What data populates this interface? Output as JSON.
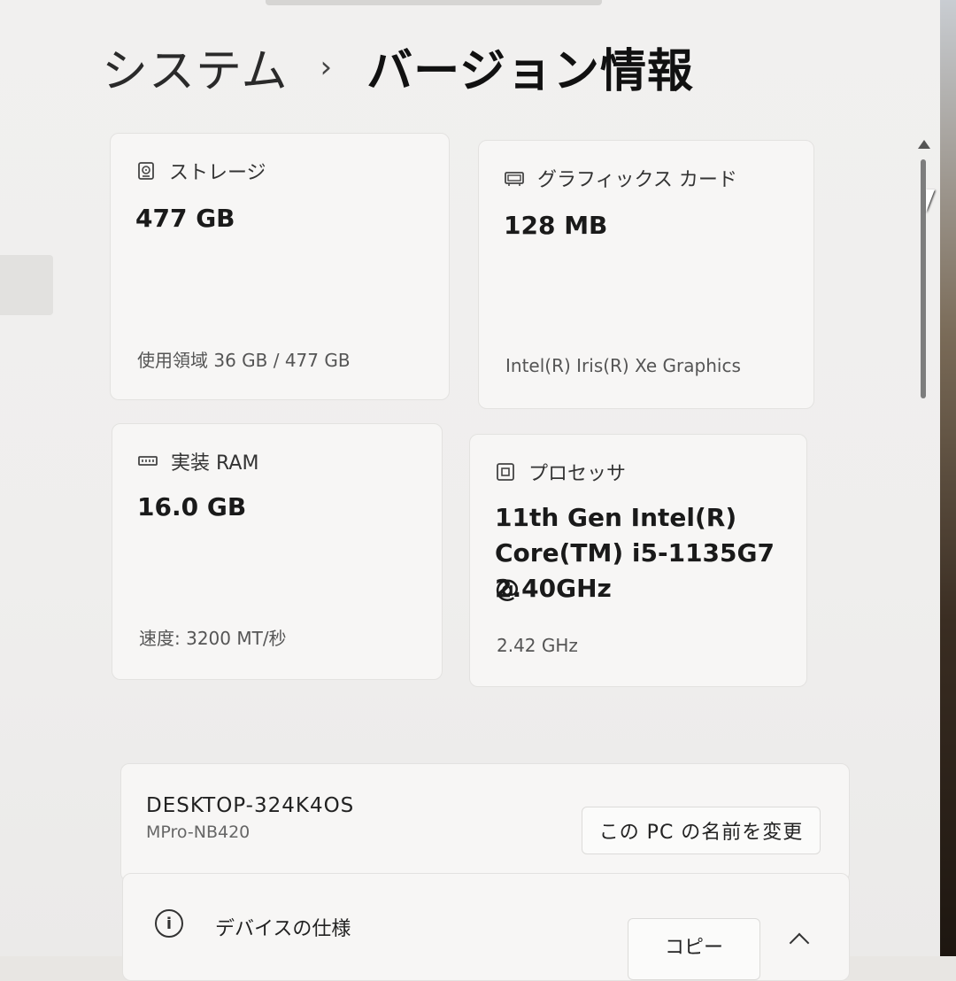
{
  "breadcrumb": {
    "parent": "システム",
    "separator": "›",
    "current": "バージョン情報"
  },
  "cards": {
    "storage": {
      "icon": "hard-drive-icon",
      "title": "ストレージ",
      "value": "477 GB",
      "sub": "使用領域 36 GB / 477 GB"
    },
    "gpu": {
      "icon": "graphics-card-icon",
      "title": "グラフィックス カード",
      "value": "128 MB",
      "sub": "Intel(R) Iris(R) Xe Graphics"
    },
    "ram": {
      "icon": "memory-icon",
      "title": "実装 RAM",
      "value": "16.0 GB",
      "sub": "速度: 3200 MT/秒"
    },
    "cpu": {
      "icon": "processor-icon",
      "title": "プロセッサ",
      "value_lines": [
        "11th Gen Intel(R)",
        "Core(TM) i5-1135G7 @",
        "2.40GHz"
      ],
      "sub": "2.42 GHz"
    }
  },
  "device": {
    "name": "DESKTOP-324K4OS",
    "model": "MPro-NB420",
    "rename_label": "この PC の名前を変更"
  },
  "specs": {
    "label": "デバイスの仕様",
    "copy_label": "コピー"
  }
}
